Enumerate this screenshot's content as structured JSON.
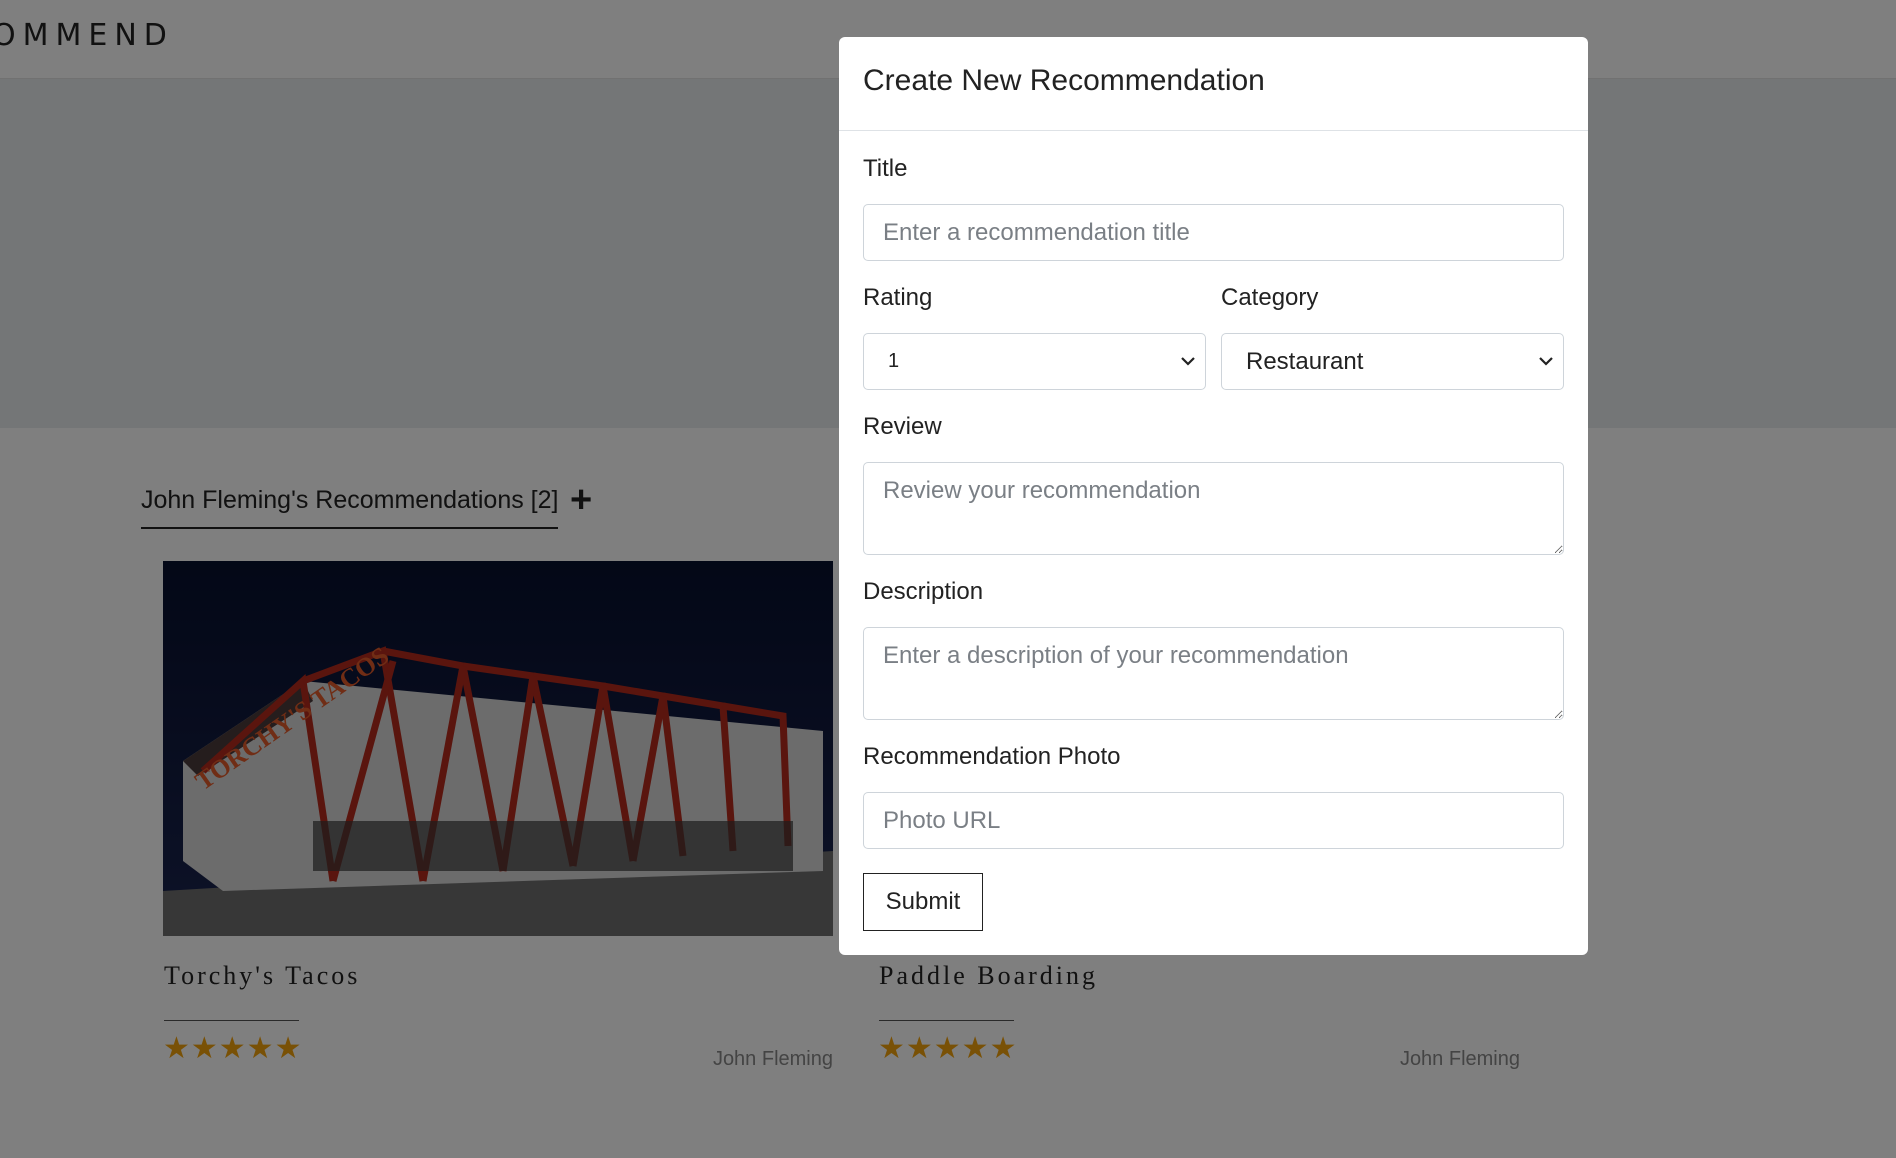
{
  "navbar": {
    "brand": "OMMEND"
  },
  "recommendations": {
    "section_title": "John Fleming's Recommendations [2]",
    "add_label": "+",
    "cards": [
      {
        "title": "Torchy's Tacos",
        "stars": "★★★★★",
        "author": "John Fleming",
        "image_sign": "TORCHY'S TACOS"
      },
      {
        "title": "Paddle Boarding",
        "stars": "★★★★★",
        "author": "John Fleming"
      }
    ]
  },
  "modal": {
    "title": "Create New Recommendation",
    "fields": {
      "title": {
        "label": "Title",
        "placeholder": "Enter a recommendation title",
        "value": ""
      },
      "rating": {
        "label": "Rating",
        "value": "1"
      },
      "category": {
        "label": "Category",
        "value": "Restaurant"
      },
      "review": {
        "label": "Review",
        "placeholder": "Review your recommendation",
        "value": ""
      },
      "description": {
        "label": "Description",
        "placeholder": "Enter a description of your recommendation",
        "value": ""
      },
      "photo": {
        "label": "Recommendation Photo",
        "placeholder": "Photo URL",
        "value": ""
      }
    },
    "submit_label": "Submit"
  },
  "colors": {
    "star": "#f2a20c",
    "backdrop": "rgba(0,0,0,0.5)"
  },
  "icons": {
    "select_chevron": "chevron-down-icon",
    "add": "plus-icon"
  }
}
